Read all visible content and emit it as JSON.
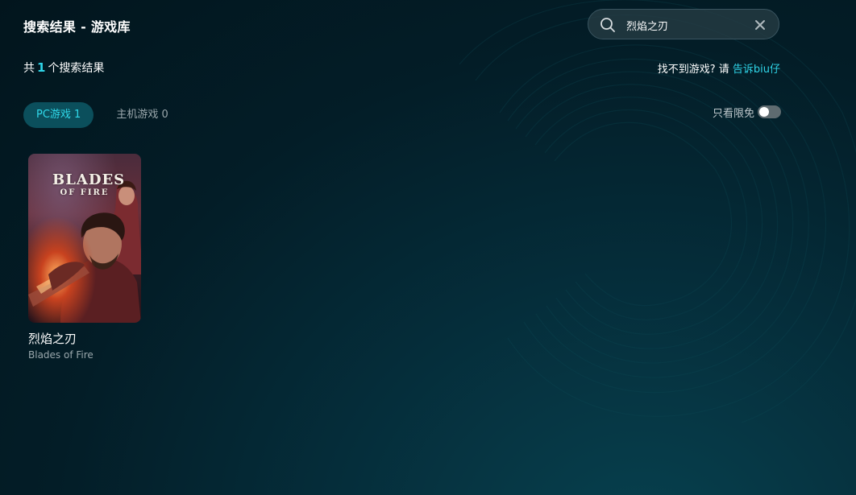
{
  "page": {
    "title": "搜索结果 - 游戏库"
  },
  "search": {
    "value": "烈焰之刃",
    "icon": "search-icon",
    "clear_icon": "close-icon"
  },
  "results": {
    "prefix": "共",
    "count": "1",
    "suffix": "个搜索结果"
  },
  "feedback": {
    "text": "找不到游戏? 请",
    "link": "告诉biu仔"
  },
  "tabs": [
    {
      "label": "PC游戏 1",
      "active": true
    },
    {
      "label": "主机游戏 0",
      "active": false
    }
  ],
  "filter": {
    "label": "只看限免",
    "enabled": false
  },
  "games": [
    {
      "title": "烈焰之刃",
      "subtitle": "Blades of Fire",
      "cover_logo": [
        "BLADES",
        "OF FIRE"
      ]
    }
  ],
  "colors": {
    "accent": "#2fd5e8",
    "background": "#03202a",
    "tab_active_bg": "#0b4f5c"
  }
}
